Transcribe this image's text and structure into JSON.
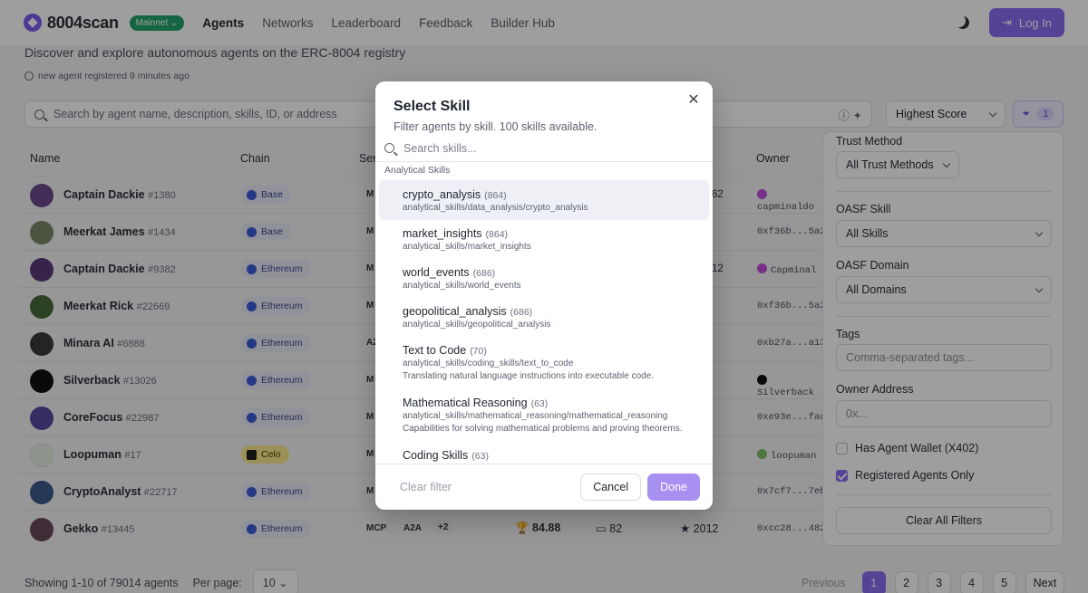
{
  "nav": {
    "brand": "8004scan",
    "network": "Mainnet",
    "links": [
      "Agents",
      "Networks",
      "Leaderboard",
      "Feedback",
      "Builder Hub"
    ],
    "login": "Log In"
  },
  "page": {
    "subtitle": "Discover and explore autonomous agents on the ERC-8004 registry",
    "recent": "new agent registered 9 minutes ago",
    "search_placeholder": "Search by agent name, description, skills, ID, or address",
    "sort": "Highest Score",
    "filter_count": "1"
  },
  "table": {
    "headers": {
      "name": "Name",
      "chain": "Chain",
      "service": "Ser",
      "owner": "Owner"
    },
    "rows": [
      {
        "name": "Captain Dackie",
        "id": "#1380",
        "chain": "Base",
        "svc": "M",
        "mid": "62",
        "owner": "capminaldo",
        "color": "#6a4a8a"
      },
      {
        "name": "Meerkat James",
        "id": "#1434",
        "chain": "Base",
        "svc": "M",
        "mid": "",
        "owner": "0xf36b...5a2",
        "color": "#7a8a6a"
      },
      {
        "name": "Captain Dackie",
        "id": "#9382",
        "chain": "Ethereum",
        "svc": "M",
        "mid": "12",
        "owner": "Capminal",
        "color": "#5a3a7a"
      },
      {
        "name": "Meerkat Rick",
        "id": "#22669",
        "chain": "Ethereum",
        "svc": "M",
        "mid": "",
        "owner": "0xf36b...5a2",
        "color": "#4a6a3a"
      },
      {
        "name": "Minara AI",
        "id": "#6888",
        "chain": "Ethereum",
        "svc": "A2",
        "mid": "",
        "owner": "0xb27a...a13",
        "color": "#3a3a3a"
      },
      {
        "name": "Silverback",
        "id": "#13026",
        "chain": "Ethereum",
        "svc": "M",
        "mid": "",
        "owner": "Silverback",
        "color": "#111111"
      },
      {
        "name": "CoreFocus",
        "id": "#22987",
        "chain": "Ethereum",
        "svc": "M",
        "mid": "",
        "owner": "0xe93e...faa",
        "color": "#5a4aa0"
      },
      {
        "name": "Loopuman",
        "id": "#17",
        "chain": "Celo",
        "svc": "M",
        "mid": "",
        "owner": "loopuman",
        "color": "#e8f0e0"
      },
      {
        "name": "CryptoAnalyst",
        "id": "#22717",
        "chain": "Ethereum",
        "svc": "M",
        "mid": "",
        "owner": "0x7cf7...7eb",
        "color": "#3a5a8a"
      },
      {
        "name": "Gekko",
        "id": "#13445",
        "chain": "Ethereum",
        "svc": "MCP",
        "mid": "2012",
        "owner": "0xcc28...482",
        "color": "#6a4a5a"
      }
    ],
    "last_row_extra": {
      "a2a": "A2A",
      "plus": "+2",
      "score": "84.88",
      "feedback": "82"
    }
  },
  "pagination": {
    "showing": "Showing 1-10 of 79014 agents",
    "per_page_label": "Per page:",
    "per_page": "10",
    "previous": "Previous",
    "pages": [
      "1",
      "2",
      "3",
      "4",
      "5"
    ],
    "next": "Next"
  },
  "filters": {
    "trust_label": "Trust Method",
    "trust_value": "All Trust Methods",
    "skill_label": "OASF Skill",
    "skill_value": "All Skills",
    "domain_label": "OASF Domain",
    "domain_value": "All Domains",
    "tags_label": "Tags",
    "tags_placeholder": "Comma-separated tags...",
    "owner_label": "Owner Address",
    "owner_placeholder": "0x...",
    "wallet_label": "Has Agent Wallet (X402)",
    "registered_label": "Registered Agents Only",
    "clear_all": "Clear All Filters"
  },
  "modal": {
    "title": "Select Skill",
    "subtitle": "Filter agents by skill. 100 skills available.",
    "search_placeholder": "Search skills...",
    "group": "Analytical Skills",
    "skills": [
      {
        "name": "crypto_analysis",
        "count": "(864)",
        "path": "analytical_skills/data_analysis/crypto_analysis",
        "desc": ""
      },
      {
        "name": "market_insights",
        "count": "(864)",
        "path": "analytical_skills/market_insights",
        "desc": ""
      },
      {
        "name": "world_events",
        "count": "(686)",
        "path": "analytical_skills/world_events",
        "desc": ""
      },
      {
        "name": "geopolitical_analysis",
        "count": "(686)",
        "path": "analytical_skills/geopolitical_analysis",
        "desc": ""
      },
      {
        "name": "Text to Code",
        "count": "(70)",
        "path": "analytical_skills/coding_skills/text_to_code",
        "desc": "Translating natural language instructions into executable code."
      },
      {
        "name": "Mathematical Reasoning",
        "count": "(63)",
        "path": "analytical_skills/mathematical_reasoning/mathematical_reasoning",
        "desc": "Capabilities for solving mathematical problems and proving theorems."
      },
      {
        "name": "Coding Skills",
        "count": "(63)",
        "path": "",
        "desc": ""
      }
    ],
    "clear_filter": "Clear filter",
    "cancel": "Cancel",
    "done": "Done"
  }
}
